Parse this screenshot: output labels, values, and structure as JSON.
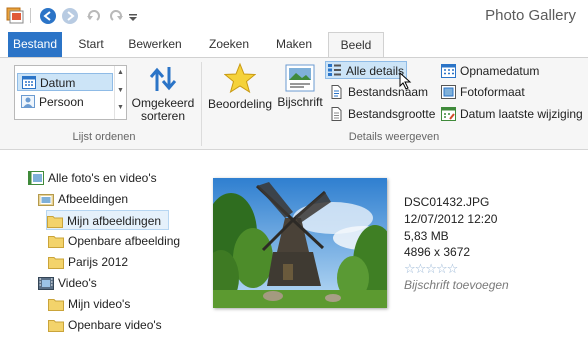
{
  "window": {
    "title": "Photo Gallery"
  },
  "tabs": [
    {
      "label": "Bestand"
    },
    {
      "label": "Start"
    },
    {
      "label": "Bewerken"
    },
    {
      "label": "Zoeken"
    },
    {
      "label": "Maken"
    },
    {
      "label": "Beeld"
    }
  ],
  "ribbon": {
    "sort": {
      "items": [
        {
          "label": "Datum"
        },
        {
          "label": "Persoon"
        }
      ],
      "reverse_label_1": "Omgekeerd",
      "reverse_label_2": "sorteren",
      "group_label": "Lijst ordenen"
    },
    "details": {
      "rating_label": "Beoordeling",
      "caption_label": "Bijschrift",
      "all_details_label": "Alle details",
      "filename_label": "Bestandsnaam",
      "filesize_label": "Bestandsgrootte",
      "date_taken_label": "Opnamedatum",
      "photo_format_label": "Fotoformaat",
      "date_modified_label": "Datum laatste wijziging",
      "group_label": "Details weergeven"
    }
  },
  "tree": [
    {
      "label": "Alle foto's en video's"
    },
    {
      "label": "Afbeeldingen"
    },
    {
      "label": "Mijn afbeeldingen"
    },
    {
      "label": "Openbare afbeelding"
    },
    {
      "label": "Parijs 2012"
    },
    {
      "label": "Video's"
    },
    {
      "label": "Mijn video's"
    },
    {
      "label": "Openbare video's"
    }
  ],
  "photo_info": {
    "filename": "DSC01432.JPG",
    "datetime": "12/07/2012 12:20",
    "size": "5,83 MB",
    "dimensions": "4896 x 3672",
    "rating_stars": "☆☆☆☆☆",
    "caption_placeholder": "Bijschrift toevoegen"
  },
  "colors": {
    "accent": "#2b74c7",
    "selection": "#cce4f7"
  }
}
